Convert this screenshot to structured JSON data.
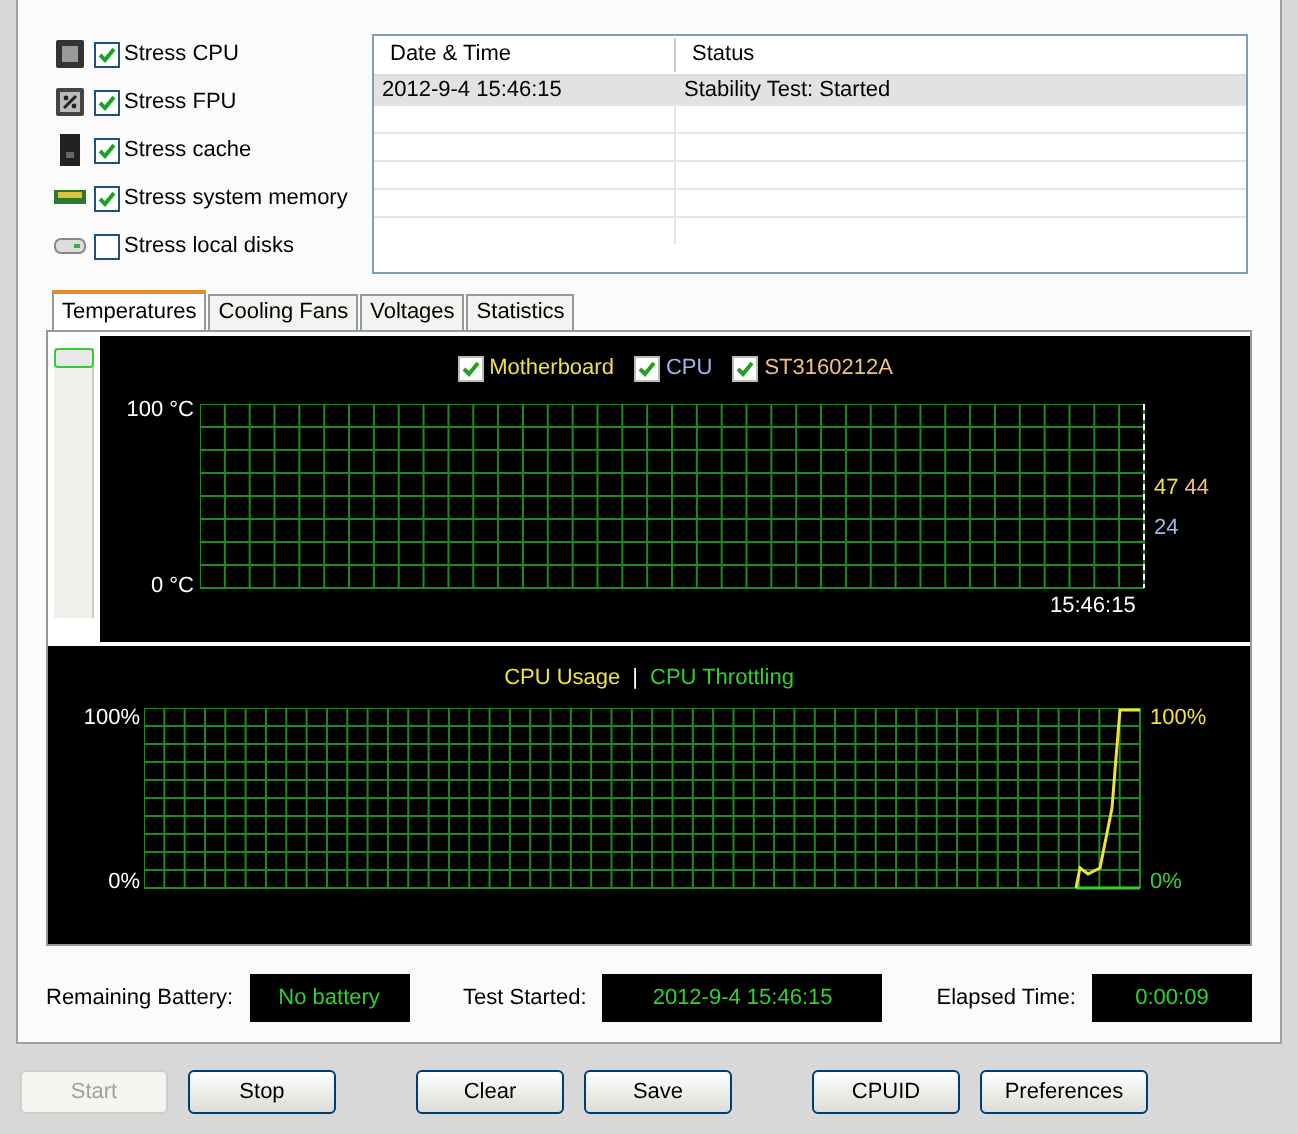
{
  "stress_options": [
    {
      "label": "Stress CPU",
      "checked": true,
      "kind": "cpu"
    },
    {
      "label": "Stress FPU",
      "checked": true,
      "kind": "fpu"
    },
    {
      "label": "Stress cache",
      "checked": true,
      "kind": "cache"
    },
    {
      "label": "Stress system memory",
      "checked": true,
      "kind": "memory"
    },
    {
      "label": "Stress local disks",
      "checked": false,
      "kind": "disk"
    }
  ],
  "log_table": {
    "columns": [
      "Date & Time",
      "Status"
    ],
    "rows": [
      {
        "cells": [
          "2012-9-4 15:46:15",
          "Stability Test: Started"
        ],
        "selected": true
      }
    ]
  },
  "tabs": [
    {
      "label": "Temperatures",
      "selected": true
    },
    {
      "label": "Cooling Fans",
      "selected": false
    },
    {
      "label": "Voltages",
      "selected": false
    },
    {
      "label": "Statistics",
      "selected": false
    }
  ],
  "zoom_slider": {
    "level": 1
  },
  "temperature_chart": {
    "legend": [
      {
        "label": "Motherboard",
        "checked": true,
        "color": "#f0e040"
      },
      {
        "label": "CPU",
        "checked": true,
        "color": "#a0b8e8"
      },
      {
        "label": "ST3160212A",
        "checked": true,
        "color": "#f0c080"
      }
    ],
    "y_max_label": "100 °C",
    "y_min_label": "0 °C",
    "readings": [
      {
        "value": "47",
        "color": "#f0e040"
      },
      {
        "value": "44",
        "color": "#f0c080"
      },
      {
        "value": "24",
        "color": "#a0b8e8"
      }
    ],
    "time": "15:46:15"
  },
  "cpu_chart": {
    "legend": [
      {
        "label": "CPU Usage",
        "color": "#f0e040"
      },
      {
        "label": "CPU Throttling",
        "color": "#30d030"
      }
    ],
    "separator": "|",
    "y_max_label": "100%",
    "y_min_label": "0%",
    "right_labels": [
      {
        "label": "100%",
        "color": "#f0e040"
      },
      {
        "label": "0%",
        "color": "#30d030"
      }
    ]
  },
  "info": [
    {
      "label": "Remaining Battery:",
      "value": "No battery"
    },
    {
      "label": "Test Started:",
      "value": "2012-9-4 15:46:15"
    },
    {
      "label": "Elapsed Time:",
      "value": "0:00:09"
    }
  ],
  "buttons": [
    {
      "label": "Start",
      "disabled": true
    },
    {
      "label": "Stop",
      "disabled": false
    },
    {
      "label": "Clear",
      "disabled": false
    },
    {
      "label": "Save",
      "disabled": false
    },
    {
      "label": "CPUID",
      "disabled": false
    },
    {
      "label": "Preferences",
      "disabled": false
    }
  ]
}
